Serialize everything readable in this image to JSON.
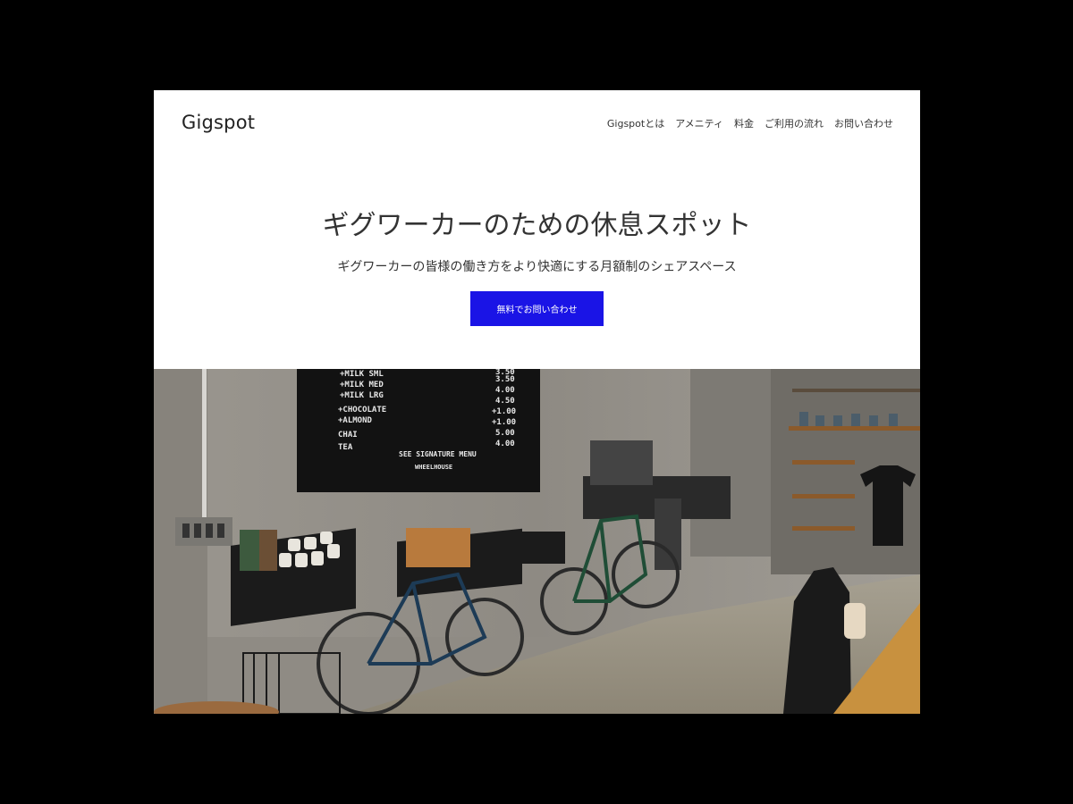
{
  "header": {
    "logo": "Gigspot",
    "nav": [
      {
        "label": "Gigspotとは"
      },
      {
        "label": "アメニティ"
      },
      {
        "label": "料金"
      },
      {
        "label": "ご利用の流れ"
      },
      {
        "label": "お問い合わせ"
      }
    ]
  },
  "hero": {
    "title": "ギグワーカーのための休息スポット",
    "subtitle": "ギグワーカーの皆様の働き方をより快適にする月額制のシェアスペース",
    "cta_label": "無料でお問い合わせ",
    "cta_color": "#1a14e6"
  },
  "photo": {
    "menu_board": {
      "lines": [
        "+MILK  SML",
        "+MILK  MED",
        "+MILK  LRG",
        "+CHOCOLATE",
        "+ALMOND",
        "CHAI",
        "TEA"
      ],
      "prices": [
        "3.50",
        "3.50",
        "4.00",
        "4.50",
        "+1.00",
        "+1.00",
        "5.00",
        "4.00"
      ],
      "footer": "SEE SIGNATURE MENU",
      "brand": "WHEELHOUSE"
    }
  }
}
